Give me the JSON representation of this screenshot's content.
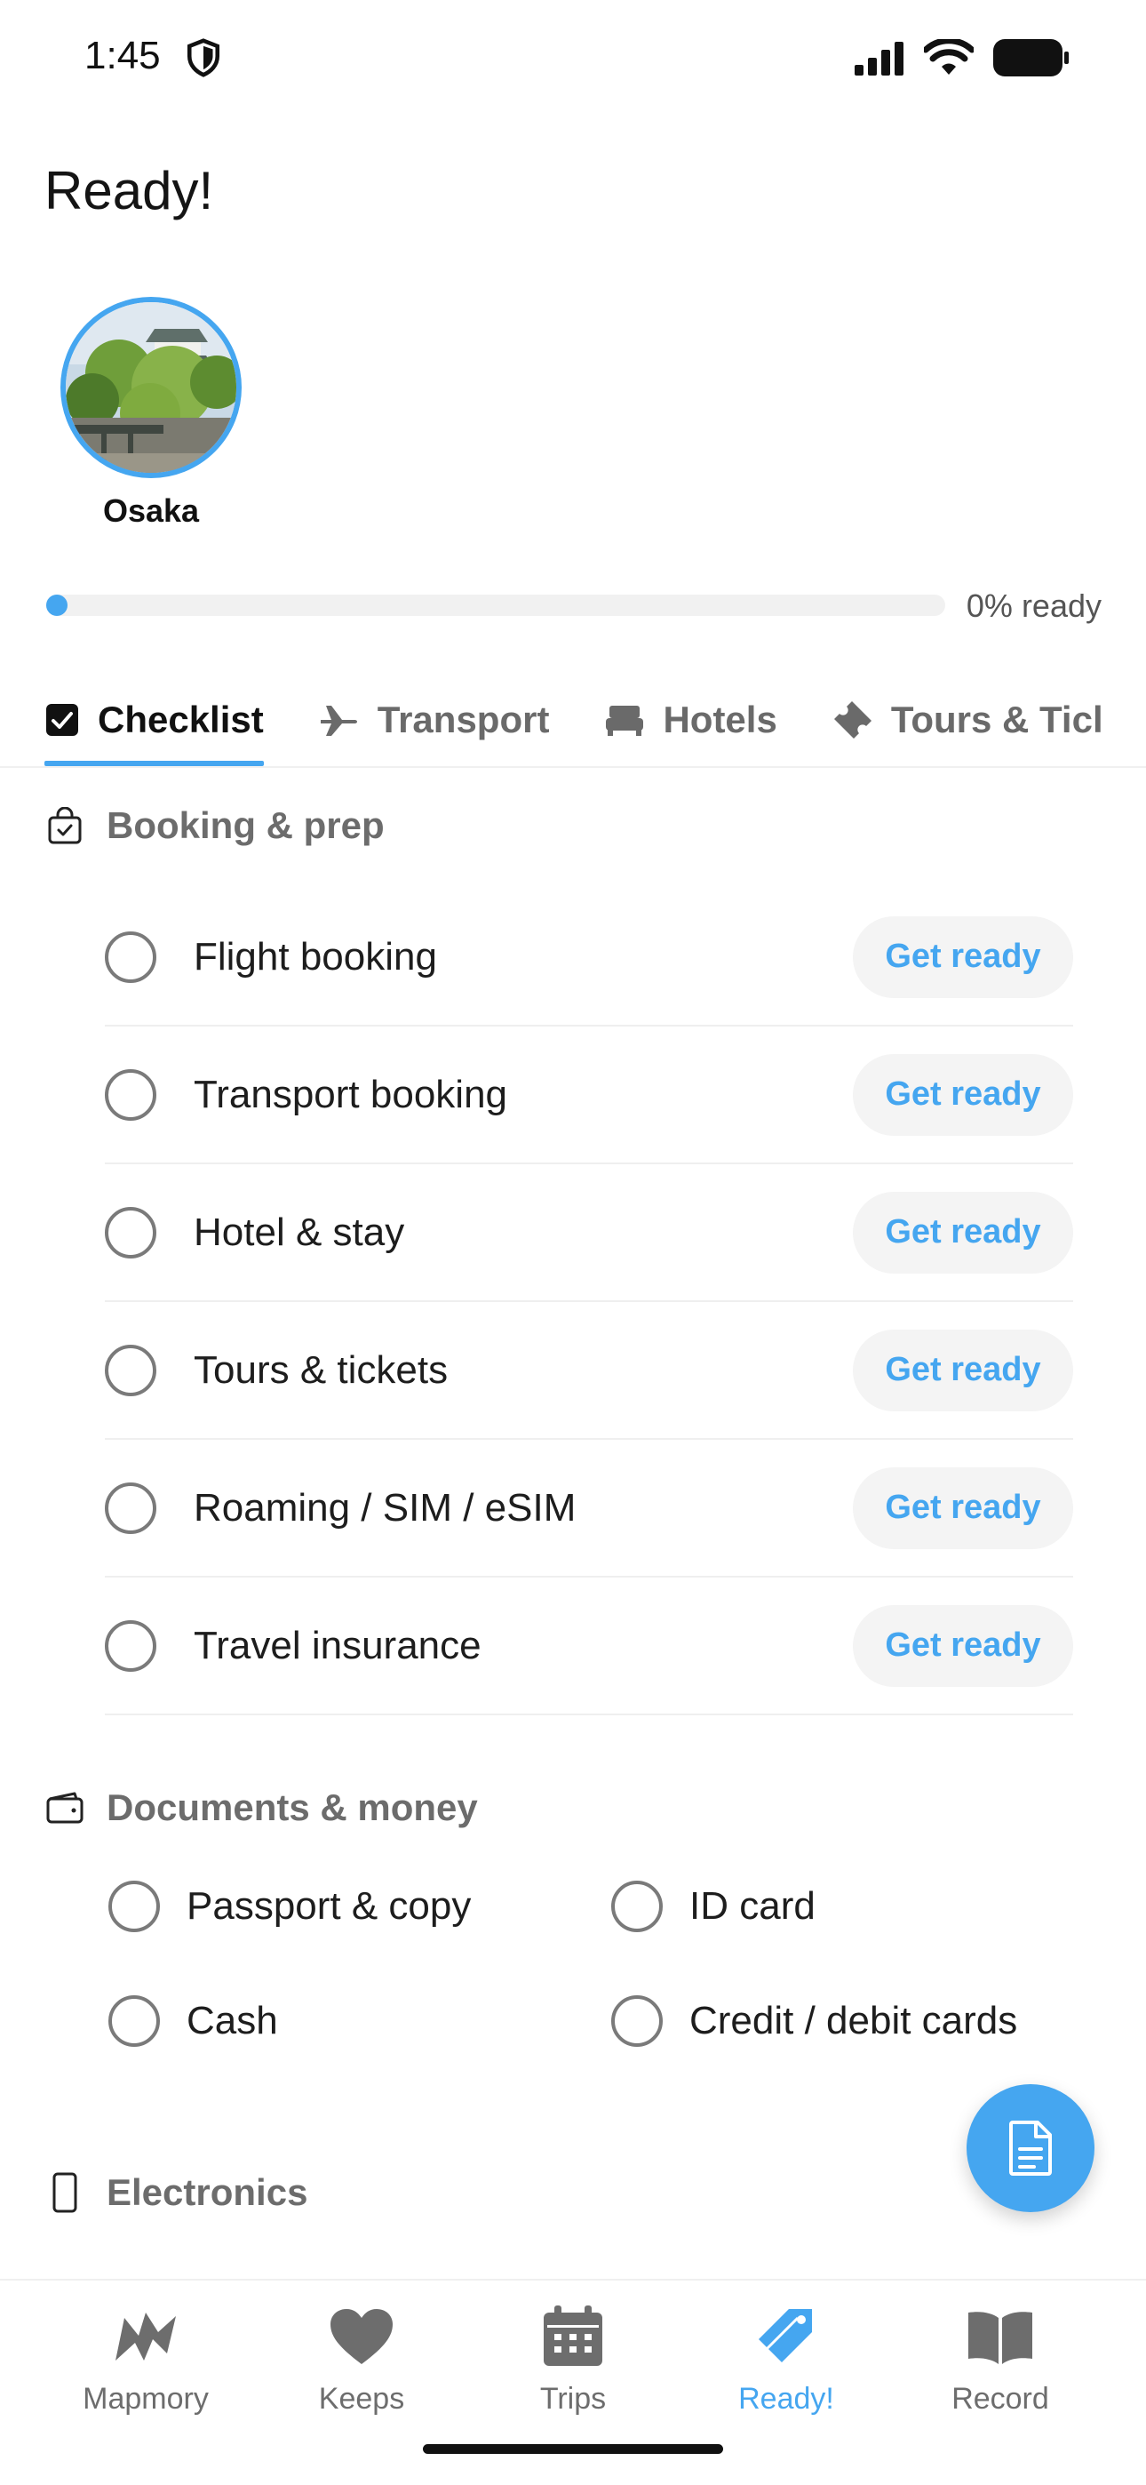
{
  "status_bar": {
    "time": "1:45"
  },
  "header": {
    "title": "Ready!"
  },
  "destination": {
    "name": "Osaka"
  },
  "progress": {
    "percent": 0,
    "label": "0% ready"
  },
  "tabs": [
    {
      "label": "Checklist",
      "icon": "checkbox-icon",
      "active": true
    },
    {
      "label": "Transport",
      "icon": "airplane-icon",
      "active": false
    },
    {
      "label": "Hotels",
      "icon": "bed-icon",
      "active": false
    },
    {
      "label": "Tours & Ticl",
      "icon": "ticket-icon",
      "active": false
    }
  ],
  "sections": {
    "booking": {
      "title": "Booking & prep",
      "icon": "shopping-bag-check-icon",
      "action_label": "Get ready",
      "items": [
        "Flight booking",
        "Transport booking",
        "Hotel & stay",
        "Tours & tickets",
        "Roaming / SIM / eSIM",
        "Travel insurance"
      ]
    },
    "documents": {
      "title": "Documents & money",
      "icon": "wallet-icon",
      "items": [
        "Passport & copy",
        "ID card",
        "Cash",
        "Credit / debit cards"
      ]
    },
    "electronics": {
      "title": "Electronics",
      "icon": "phone-icon"
    }
  },
  "fab": {
    "icon": "document-icon"
  },
  "bottom_nav": [
    {
      "label": "Mapmory",
      "icon": "map-brush-icon",
      "active": false
    },
    {
      "label": "Keeps",
      "icon": "heart-icon",
      "active": false
    },
    {
      "label": "Trips",
      "icon": "calendar-icon",
      "active": false
    },
    {
      "label": "Ready!",
      "icon": "tag-icon",
      "active": true
    },
    {
      "label": "Record",
      "icon": "book-icon",
      "active": false
    }
  ],
  "colors": {
    "accent": "#45a6f0",
    "muted_text": "#6c6c6c"
  }
}
